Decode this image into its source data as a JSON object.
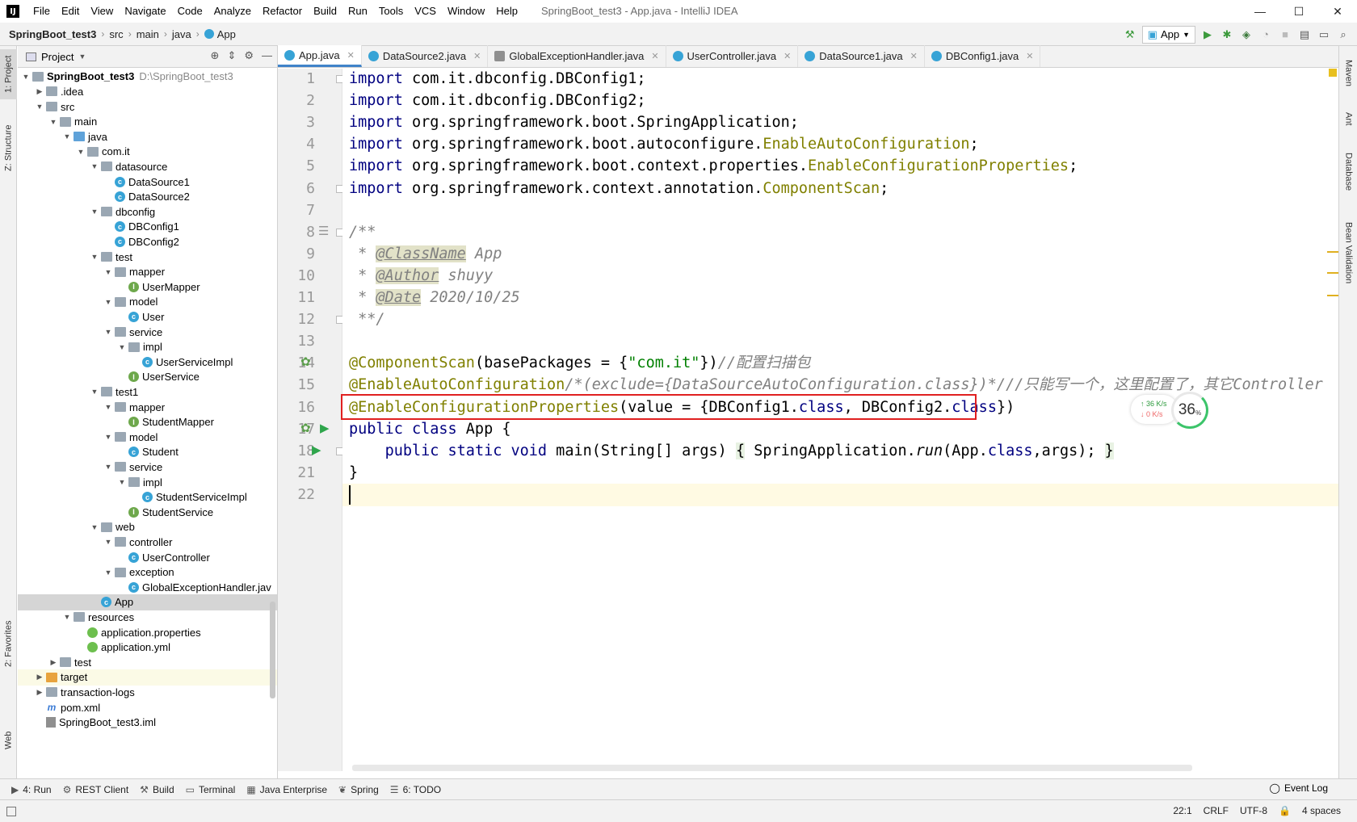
{
  "window": {
    "logo": "IJ",
    "title": "SpringBoot_test3 - App.java - IntelliJ IDEA",
    "controls": [
      "—",
      "☐",
      "✕"
    ]
  },
  "menu": [
    "File",
    "Edit",
    "View",
    "Navigate",
    "Code",
    "Analyze",
    "Refactor",
    "Build",
    "Run",
    "Tools",
    "VCS",
    "Window",
    "Help"
  ],
  "breadcrumb": [
    "SpringBoot_test3",
    "src",
    "main",
    "java",
    "App"
  ],
  "run_config": "App",
  "left_strip": [
    "1: Project",
    "Z: Structure",
    "2: Favorites",
    "Web"
  ],
  "right_strip": [
    "Maven",
    "Ant",
    "Database",
    "Bean Validation"
  ],
  "project_panel": {
    "title": "Project",
    "tree": [
      {
        "depth": 0,
        "arrow": "open",
        "icon": "folder",
        "label": "SpringBoot_test3",
        "extra": "D:\\SpringBoot_test3",
        "bold": true
      },
      {
        "depth": 1,
        "arrow": "closed",
        "icon": "folder",
        "label": ".idea"
      },
      {
        "depth": 1,
        "arrow": "open",
        "icon": "folder",
        "label": "src"
      },
      {
        "depth": 2,
        "arrow": "open",
        "icon": "folder",
        "label": "main"
      },
      {
        "depth": 3,
        "arrow": "open",
        "icon": "folder-src",
        "label": "java"
      },
      {
        "depth": 4,
        "arrow": "open",
        "icon": "folder",
        "label": "com.it"
      },
      {
        "depth": 5,
        "arrow": "open",
        "icon": "folder",
        "label": "datasource"
      },
      {
        "depth": 6,
        "arrow": "",
        "icon": "cls",
        "label": "DataSource1"
      },
      {
        "depth": 6,
        "arrow": "",
        "icon": "cls",
        "label": "DataSource2"
      },
      {
        "depth": 5,
        "arrow": "open",
        "icon": "folder",
        "label": "dbconfig"
      },
      {
        "depth": 6,
        "arrow": "",
        "icon": "cls",
        "label": "DBConfig1"
      },
      {
        "depth": 6,
        "arrow": "",
        "icon": "cls",
        "label": "DBConfig2"
      },
      {
        "depth": 5,
        "arrow": "open",
        "icon": "folder",
        "label": "test"
      },
      {
        "depth": 6,
        "arrow": "open",
        "icon": "folder",
        "label": "mapper"
      },
      {
        "depth": 7,
        "arrow": "",
        "icon": "intf",
        "label": "UserMapper"
      },
      {
        "depth": 6,
        "arrow": "open",
        "icon": "folder",
        "label": "model"
      },
      {
        "depth": 7,
        "arrow": "",
        "icon": "cls",
        "label": "User"
      },
      {
        "depth": 6,
        "arrow": "open",
        "icon": "folder",
        "label": "service"
      },
      {
        "depth": 7,
        "arrow": "open",
        "icon": "folder",
        "label": "impl"
      },
      {
        "depth": 8,
        "arrow": "",
        "icon": "cls",
        "label": "UserServiceImpl"
      },
      {
        "depth": 7,
        "arrow": "",
        "icon": "intf",
        "label": "UserService"
      },
      {
        "depth": 5,
        "arrow": "open",
        "icon": "folder",
        "label": "test1"
      },
      {
        "depth": 6,
        "arrow": "open",
        "icon": "folder",
        "label": "mapper"
      },
      {
        "depth": 7,
        "arrow": "",
        "icon": "intf",
        "label": "StudentMapper"
      },
      {
        "depth": 6,
        "arrow": "open",
        "icon": "folder",
        "label": "model"
      },
      {
        "depth": 7,
        "arrow": "",
        "icon": "cls",
        "label": "Student"
      },
      {
        "depth": 6,
        "arrow": "open",
        "icon": "folder",
        "label": "service"
      },
      {
        "depth": 7,
        "arrow": "open",
        "icon": "folder",
        "label": "impl"
      },
      {
        "depth": 8,
        "arrow": "",
        "icon": "cls",
        "label": "StudentServiceImpl"
      },
      {
        "depth": 7,
        "arrow": "",
        "icon": "intf",
        "label": "StudentService"
      },
      {
        "depth": 5,
        "arrow": "open",
        "icon": "folder",
        "label": "web"
      },
      {
        "depth": 6,
        "arrow": "open",
        "icon": "folder",
        "label": "controller"
      },
      {
        "depth": 7,
        "arrow": "",
        "icon": "cls",
        "label": "UserController"
      },
      {
        "depth": 6,
        "arrow": "open",
        "icon": "folder",
        "label": "exception"
      },
      {
        "depth": 7,
        "arrow": "",
        "icon": "cls",
        "label": "GlobalExceptionHandler.jav"
      },
      {
        "depth": 5,
        "arrow": "",
        "icon": "cls",
        "label": "App",
        "selected": true
      },
      {
        "depth": 3,
        "arrow": "open",
        "icon": "folder",
        "label": "resources"
      },
      {
        "depth": 4,
        "arrow": "",
        "icon": "leaf",
        "label": "application.properties"
      },
      {
        "depth": 4,
        "arrow": "",
        "icon": "leaf",
        "label": "application.yml"
      },
      {
        "depth": 2,
        "arrow": "closed",
        "icon": "folder",
        "label": "test"
      },
      {
        "depth": 1,
        "arrow": "closed",
        "icon": "folder-orange",
        "label": "target",
        "highlight": true
      },
      {
        "depth": 1,
        "arrow": "closed",
        "icon": "folder",
        "label": "transaction-logs"
      },
      {
        "depth": 1,
        "arrow": "",
        "icon": "xml",
        "label": "pom.xml"
      },
      {
        "depth": 1,
        "arrow": "",
        "icon": "iml",
        "label": "SpringBoot_test3.iml"
      }
    ]
  },
  "tabs": [
    {
      "label": "App.java",
      "active": true,
      "icon": "c"
    },
    {
      "label": "DataSource2.java",
      "icon": "c"
    },
    {
      "label": "GlobalExceptionHandler.java",
      "icon": "g"
    },
    {
      "label": "UserController.java",
      "icon": "c"
    },
    {
      "label": "DataSource1.java",
      "icon": "c"
    },
    {
      "label": "DBConfig1.java",
      "icon": "c"
    }
  ],
  "code": {
    "line_numbers": [
      "1",
      "2",
      "3",
      "4",
      "5",
      "6",
      "7",
      "8",
      "9",
      "10",
      "11",
      "12",
      "13",
      "14",
      "15",
      "16",
      "17",
      "18",
      "21",
      "22"
    ],
    "lines": [
      [
        [
          "kw",
          "import"
        ],
        [
          "t",
          " com.it.dbconfig.DBConfig1;"
        ]
      ],
      [
        [
          "kw",
          "import"
        ],
        [
          "t",
          " com.it.dbconfig.DBConfig2;"
        ]
      ],
      [
        [
          "kw",
          "import"
        ],
        [
          "t",
          " org.springframework.boot.SpringApplication;"
        ]
      ],
      [
        [
          "kw",
          "import"
        ],
        [
          "t",
          " org.springframework.boot.autoconfigure."
        ],
        [
          "ann",
          "EnableAutoConfiguration"
        ],
        [
          "t",
          ";"
        ]
      ],
      [
        [
          "kw",
          "import"
        ],
        [
          "t",
          " org.springframework.boot.context.properties."
        ],
        [
          "ann",
          "EnableConfigurationProperties"
        ],
        [
          "t",
          ";"
        ]
      ],
      [
        [
          "kw",
          "import"
        ],
        [
          "t",
          " org.springframework.context.annotation."
        ],
        [
          "ann",
          "ComponentScan"
        ],
        [
          "t",
          ";"
        ]
      ],
      [],
      [
        [
          "cm",
          "/**"
        ]
      ],
      [
        [
          "cm",
          " * "
        ],
        [
          "tag",
          "@ClassName"
        ],
        [
          "cm",
          " App"
        ]
      ],
      [
        [
          "cm",
          " * "
        ],
        [
          "tag",
          "@Author"
        ],
        [
          "cm",
          " shuyy"
        ]
      ],
      [
        [
          "cm",
          " * "
        ],
        [
          "tag",
          "@Date"
        ],
        [
          "cm",
          " 2020/10/25"
        ]
      ],
      [
        [
          "cm",
          " **/"
        ]
      ],
      [],
      [
        [
          "ann",
          "@ComponentScan"
        ],
        [
          "t",
          "(basePackages = {"
        ],
        [
          "str",
          "\"com.it\""
        ],
        [
          "t",
          "})"
        ],
        [
          "cm",
          "//配置扫描包"
        ]
      ],
      [
        [
          "ann",
          "@EnableAutoConfiguration"
        ],
        [
          "cm",
          "/*(exclude={DataSourceAutoConfiguration.class})*///只能写一个，这里配置了，其它Controller"
        ]
      ],
      [
        [
          "ann",
          "@EnableConfigurationProperties"
        ],
        [
          "t",
          "(value = {DBConfig1."
        ],
        [
          "kw",
          "class"
        ],
        [
          "t",
          ", DBConfig2."
        ],
        [
          "kw",
          "class"
        ],
        [
          "t",
          "})"
        ]
      ],
      [
        [
          "kw",
          "public class"
        ],
        [
          "t",
          " App {"
        ]
      ],
      [
        [
          "t",
          "    "
        ],
        [
          "kw",
          "public static void"
        ],
        [
          "t",
          " main(String[] args) "
        ],
        [
          "br",
          "{"
        ],
        [
          "t",
          " SpringApplication."
        ],
        [
          "mth",
          "run"
        ],
        [
          "t",
          "(App."
        ],
        [
          "kw",
          "class"
        ],
        [
          "t",
          ",args); "
        ],
        [
          "br",
          "}"
        ]
      ],
      [
        [
          "t",
          "}"
        ]
      ],
      []
    ]
  },
  "net_widget": {
    "up": "36 K/s",
    "down": "0  K/s",
    "percent": "36",
    "unit": "%"
  },
  "bottom_tools": [
    {
      "icon": "▶",
      "label": "4: Run"
    },
    {
      "icon": "⚙",
      "label": "REST Client"
    },
    {
      "icon": "⚒",
      "label": "Build"
    },
    {
      "icon": "▭",
      "label": "Terminal"
    },
    {
      "icon": "▦",
      "label": "Java Enterprise"
    },
    {
      "icon": "❦",
      "label": "Spring"
    },
    {
      "icon": "☰",
      "label": "6: TODO"
    }
  ],
  "event_log": "Event Log",
  "status": {
    "position": "22:1",
    "line_sep": "CRLF",
    "encoding": "UTF-8",
    "indent": "4 spaces"
  }
}
